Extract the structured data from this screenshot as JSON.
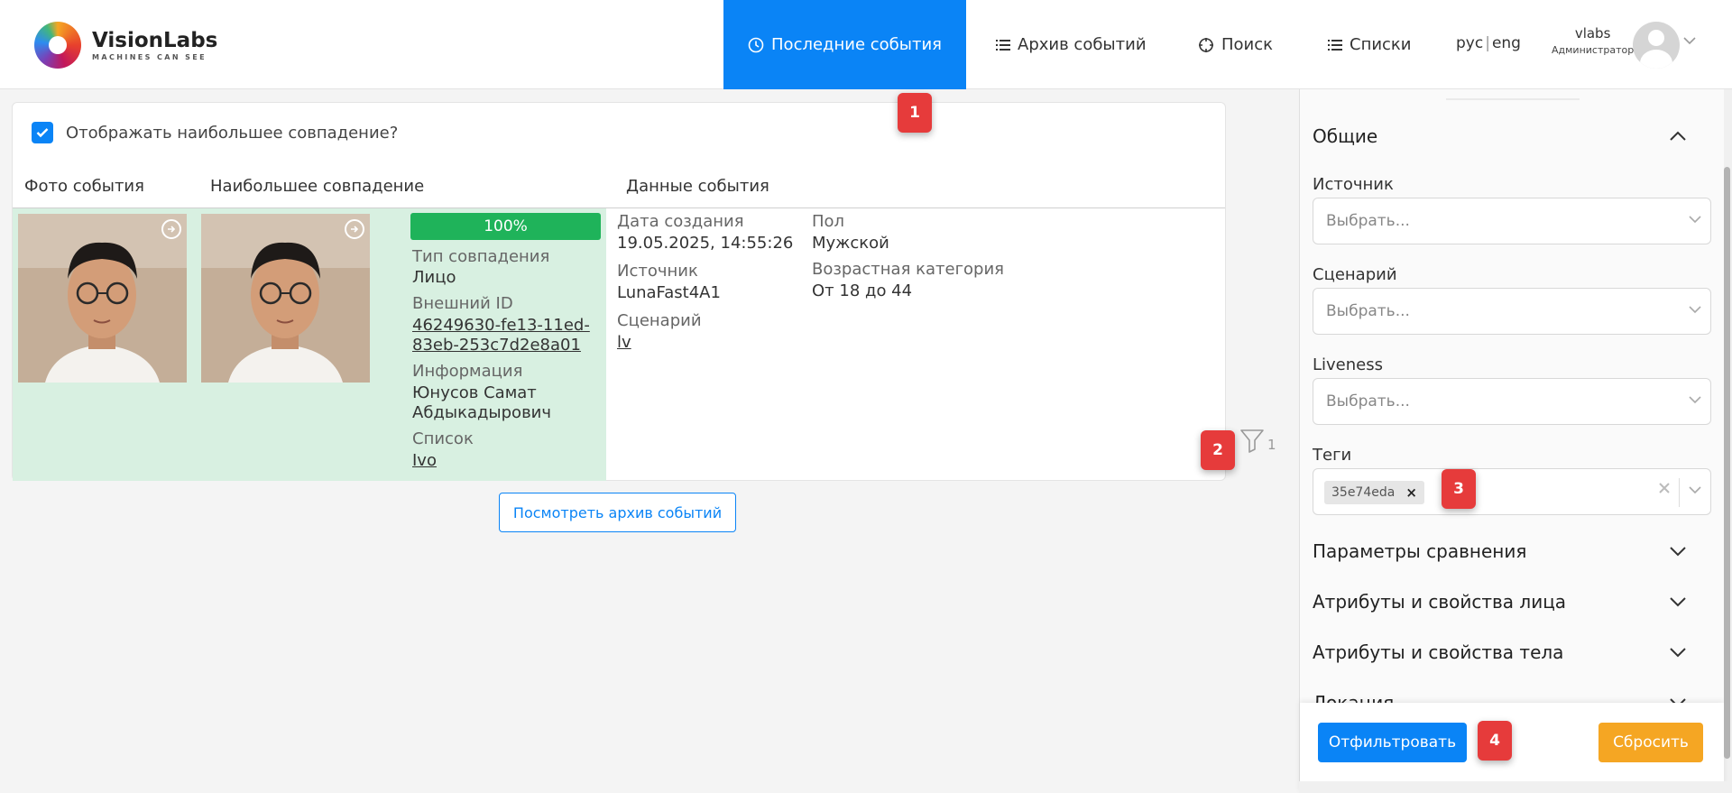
{
  "header": {
    "logo_title": "VisionLabs",
    "logo_subtitle": "MACHINES CAN SEE",
    "nav": {
      "recent": "Последние события",
      "archive": "Архив событий",
      "search": "Поиск",
      "lists": "Списки"
    },
    "lang_ru": "рус",
    "lang_en": "eng",
    "user_name": "vlabs",
    "user_role": "Администратор"
  },
  "main": {
    "show_best_match": "Отображать наибольшее совпадение?",
    "columns": {
      "photo": "Фото события",
      "best_match": "Наибольшее совпадение",
      "event_data": "Данные события"
    },
    "event": {
      "similarity": "100%",
      "match_type_label": "Тип совпадения",
      "match_type": "Лицо",
      "external_id_label": "Внешний ID",
      "external_id_line1": "46249630-fe13-11ed-",
      "external_id_line2": "83eb-253c7d2e8a01",
      "info_label": "Информация",
      "info_line1": "Юнусов Самат",
      "info_line2": "Абдыкадырович",
      "list_label": "Список",
      "list": "Ivo",
      "created_label": "Дата создания",
      "created": "19.05.2025, 14:55:26",
      "source_label": "Источник",
      "source": "LunaFast4A1",
      "scenario_label": "Сценарий",
      "scenario": "lv",
      "gender_label": "Пол",
      "gender": "Мужской",
      "age_label": "Возрастная категория",
      "age": "От 18 до 44"
    },
    "filter_count": "1",
    "archive_button": "Посмотреть архив событий"
  },
  "panel": {
    "general": "Общие",
    "source_label": "Источник",
    "source_placeholder": "Выбрать...",
    "scenario_label": "Сценарий",
    "scenario_placeholder": "Выбрать...",
    "liveness_label": "Liveness",
    "liveness_placeholder": "Выбрать...",
    "tags_label": "Теги",
    "tag": "35e74eda",
    "compare_params": "Параметры сравнения",
    "face_attrs": "Атрибуты и свойства лица",
    "body_attrs": "Атрибуты и свойства тела",
    "location": "Локация",
    "filter_button": "Отфильтровать",
    "reset_button": "Сбросить"
  },
  "badges": [
    "1",
    "2",
    "3",
    "4"
  ],
  "colors": {
    "accent": "#0a84f6",
    "match_green": "#1fb35a",
    "row_bg": "#d8f0e1",
    "reset": "#f5a623",
    "badge": "#e63b3b"
  }
}
